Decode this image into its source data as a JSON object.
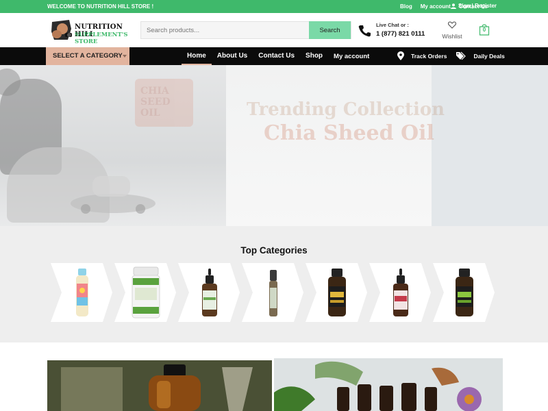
{
  "topbar": {
    "welcome": "WELCOME TO NUTRITION HILL STORE !",
    "links": [
      "Blog",
      "My account",
      "Contact Us"
    ],
    "account": "Sign | Register",
    "color": "#3fb96b"
  },
  "logo": {
    "line1": "NUTRITION HILL",
    "line2": "SUPPLEMENT'S STORE"
  },
  "search": {
    "placeholder": "Search products...",
    "button": "Search"
  },
  "chat": {
    "label": "Live Chat or :",
    "phone": "1 (877) 821 0111"
  },
  "wishlist": {
    "label": "Wishlist"
  },
  "cart": {
    "count": "0"
  },
  "nav": {
    "category_button": "SELECT A CATEGORY",
    "menu": [
      "Home",
      "About Us",
      "Contact Us",
      "Shop",
      "My account"
    ],
    "active": "Home",
    "track": "Track Orders",
    "deals": "Daily Deals",
    "category_color": "#e2b49e"
  },
  "hero": {
    "bottle_text": "CHIA SEED OIL",
    "headline": "Trending Collection",
    "subheadline": "Chia Sheed Oil"
  },
  "categories": {
    "title": "Top Categories",
    "items": [
      {
        "icon": "kids-sunscreen-bottle-icon"
      },
      {
        "icon": "marshmallow-supplement-jar-icon"
      },
      {
        "icon": "dropper-bottle-green-icon"
      },
      {
        "icon": "roll-on-bottle-icon"
      },
      {
        "icon": "tincture-bottle-yellow-icon"
      },
      {
        "icon": "dropper-bottle-red-icon"
      },
      {
        "icon": "tincture-bottle-green-icon"
      }
    ]
  }
}
